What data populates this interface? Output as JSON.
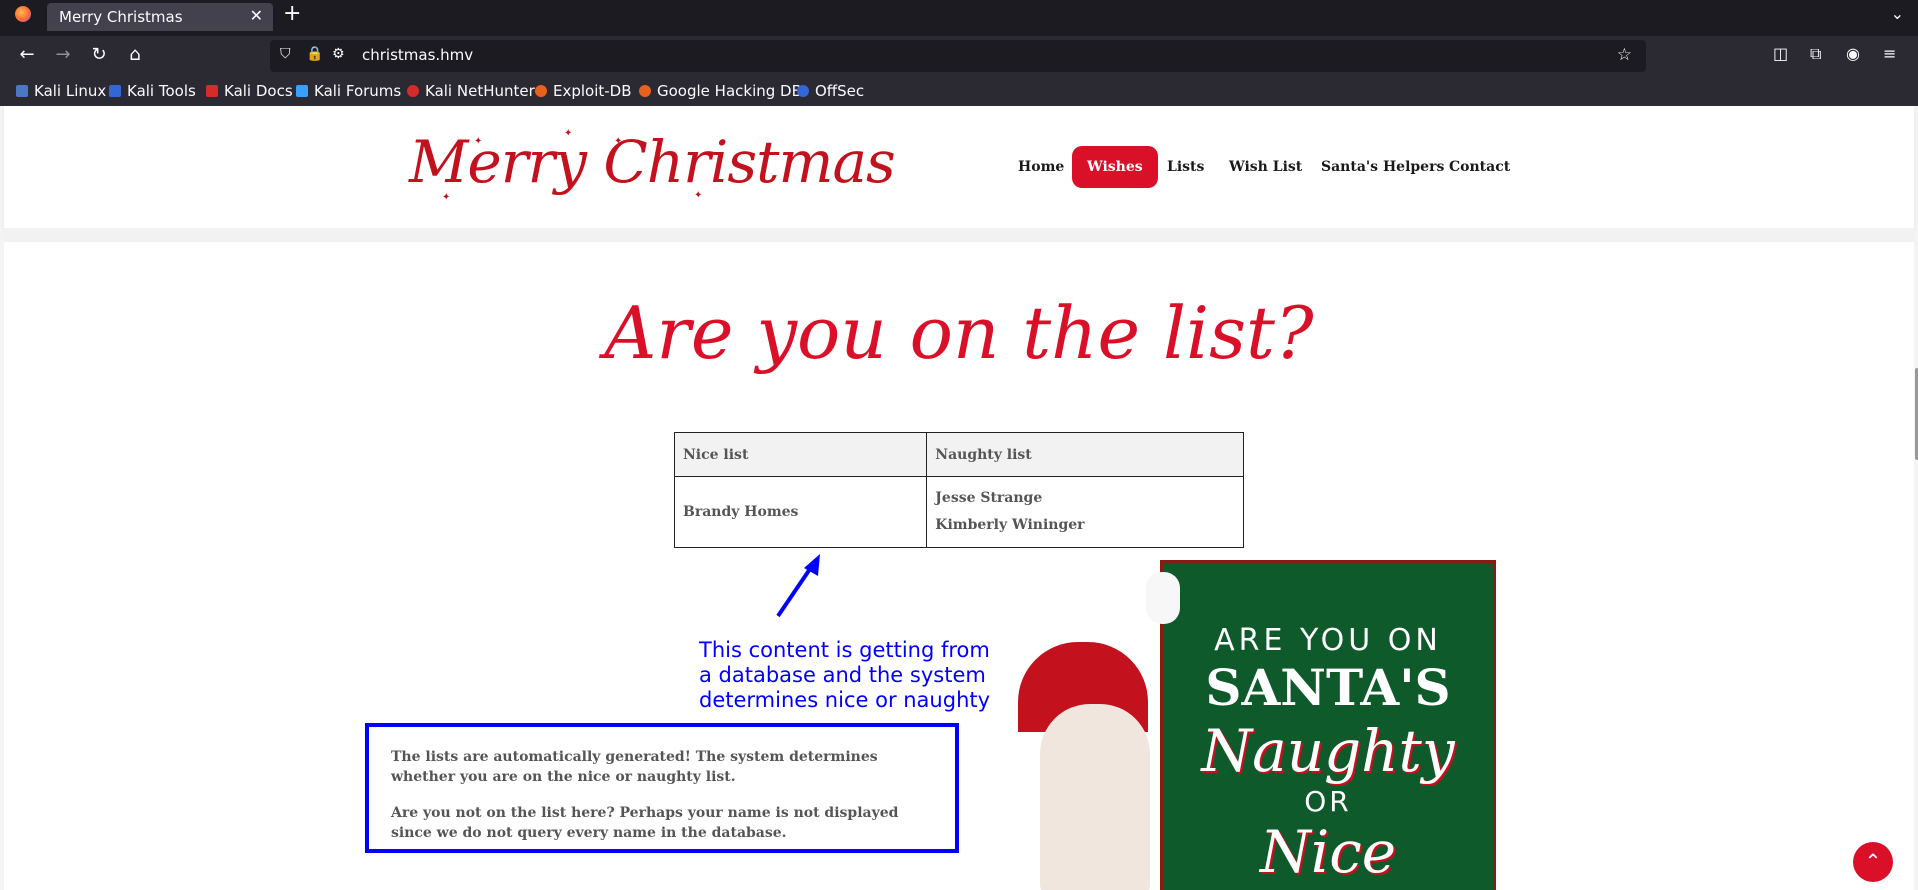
{
  "browser": {
    "tab_title": "Merry Christmas",
    "tab_close": "✕",
    "new_tab": "+",
    "url": "christmas.hmv",
    "bookmarks": [
      "Kali Linux",
      "Kali Tools",
      "Kali Docs",
      "Kali Forums",
      "Kali NetHunter",
      "Exploit-DB",
      "Google Hacking DB",
      "OffSec"
    ]
  },
  "site": {
    "logo_text": "Merry Christmas",
    "nav": [
      "Home",
      "Wishes",
      "Lists",
      "Wish List",
      "Santa's Helpers",
      "Contact"
    ],
    "active_nav": "Wishes",
    "heading": "Are you on the list?",
    "table": {
      "headers": [
        "Nice list",
        "Naughty list"
      ],
      "nice": [
        "Brandy Homes"
      ],
      "naughty": [
        "Jesse Strange",
        "Kimberly Wininger"
      ]
    },
    "annotation": [
      "This content is getting from",
      "a database and the system",
      "determines nice or naughty"
    ],
    "info": [
      "The lists are automatically generated! The system determines whether you are on the nice or naughty list.",
      "Are you not on the list here? Perhaps your name is not displayed since we do not query every name in the database."
    ],
    "santa_sign": [
      "ARE YOU ON",
      "SANTA'S",
      "Naughty",
      "OR",
      "Nice"
    ]
  },
  "colors": {
    "brand_red": "#d91028",
    "annotation_blue": "#0000ff",
    "sign_green": "#0e5a2a"
  }
}
